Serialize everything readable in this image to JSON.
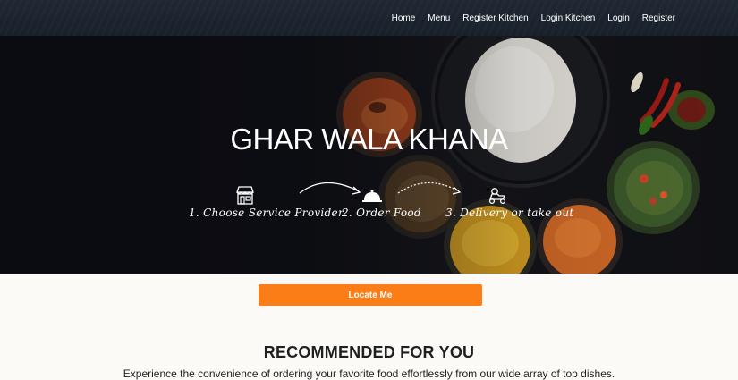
{
  "nav": {
    "items": [
      {
        "label": "Home"
      },
      {
        "label": "Menu"
      },
      {
        "label": "Register Kitchen"
      },
      {
        "label": "Login Kitchen"
      },
      {
        "label": "Login"
      },
      {
        "label": "Register"
      }
    ]
  },
  "hero": {
    "title": "GHAR WALA KHANA",
    "steps": [
      {
        "label": "1. Choose Service Provider",
        "icon": "storefront-icon"
      },
      {
        "label": "2. Order Food",
        "icon": "cloche-icon"
      },
      {
        "label": "3. Delivery or take out",
        "icon": "delivery-scooter-icon"
      }
    ]
  },
  "locate": {
    "label": "Locate Me"
  },
  "recommended": {
    "title": "RECOMMENDED FOR YOU",
    "subtitle": "Experience the convenience of ordering your favorite food effortlessly from our wide array of top dishes."
  },
  "colors": {
    "accent": "#fb7d17",
    "navbar": "#1c242e",
    "hero_bg": "#0d0e13"
  }
}
